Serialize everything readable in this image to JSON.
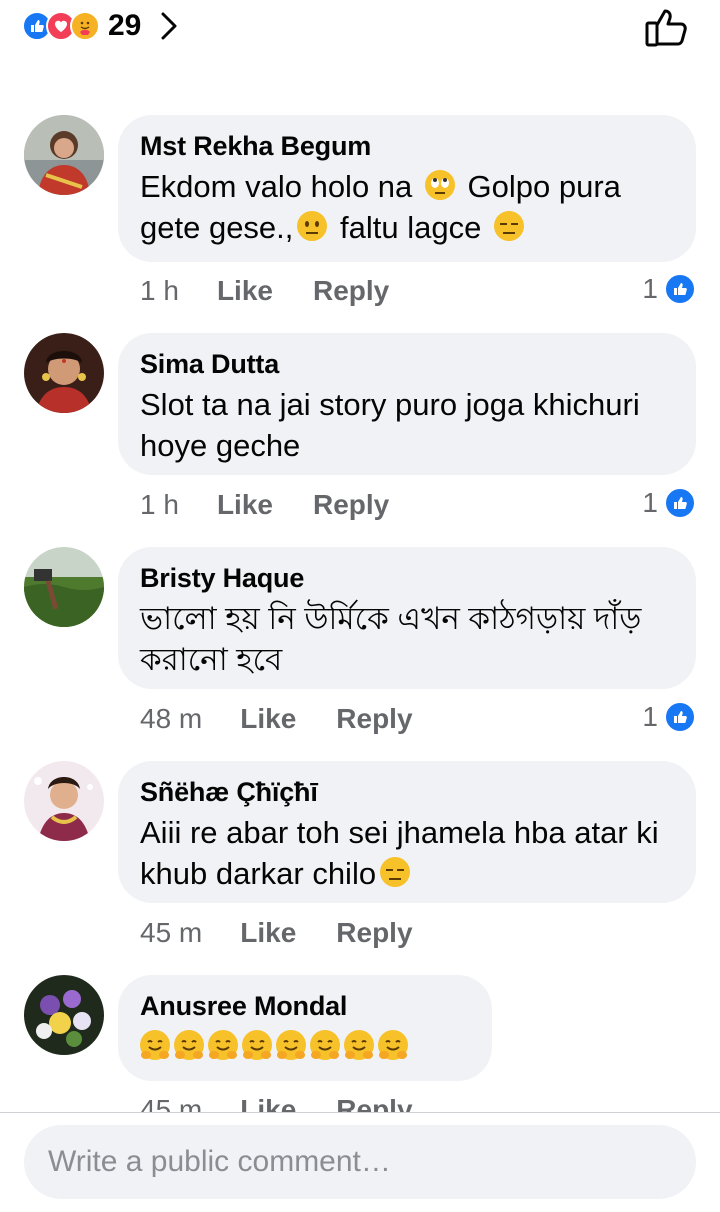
{
  "reactions": {
    "count": "29",
    "types": [
      "like-icon",
      "love-icon",
      "care-icon"
    ]
  },
  "colors": {
    "accent": "#1877f2",
    "bubble": "#f0f2f5",
    "meta": "#65676b"
  },
  "labels": {
    "like": "Like",
    "reply": "Reply"
  },
  "comments": [
    {
      "author": "Mst Rekha Begum",
      "text_parts": [
        "Ekdom valo holo na ",
        " Golpo pura",
        "gete gese.,",
        " faltu lagce "
      ],
      "time": "1 h",
      "likes": "1"
    },
    {
      "author": "Sima Dutta",
      "text": "Slot ta na jai story puro joga khichuri hoye geche",
      "time": "1 h",
      "likes": "1"
    },
    {
      "author": "Bristy Haque",
      "text": "ভালো হয় নি উর্মিকে এখন কাঠগড়ায় দাঁড় করানো হবে",
      "time": "48 m",
      "likes": "1"
    },
    {
      "author": "Sñëhæ Çħïçħī",
      "text": "Aiii re abar toh sei jhamela hba atar ki khub darkar chilo",
      "time": "45 m",
      "likes": ""
    },
    {
      "author": "Anusree Mondal",
      "text": "",
      "time": "45 m",
      "likes": ""
    }
  ],
  "composer": {
    "placeholder": "Write a public comment…"
  }
}
